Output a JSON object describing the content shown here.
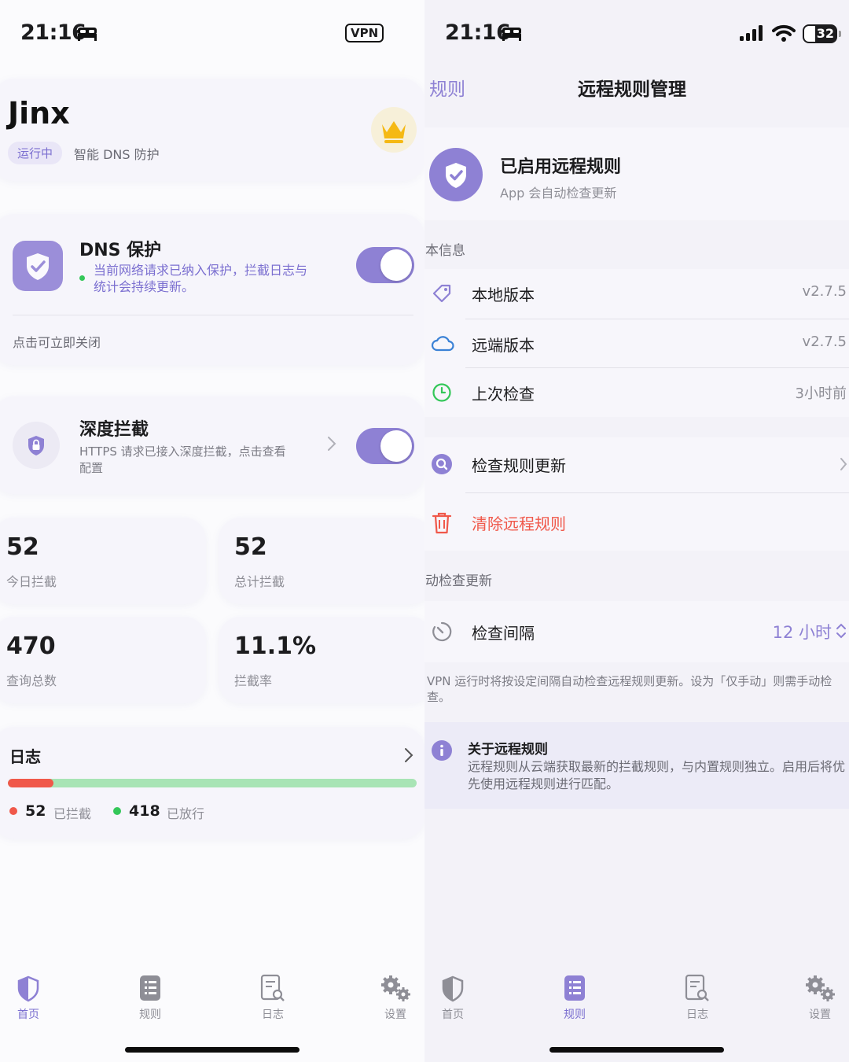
{
  "status": {
    "time": "21:16",
    "vpn_badge": "VPN",
    "battery": "32"
  },
  "home": {
    "app_name": "Jinx",
    "status_pill": "运行中",
    "subtitle": "智能 DNS 防护",
    "dns": {
      "title": "DNS 保护",
      "description": "当前网络请求已纳入保护，拦截日志与统计会持续更新。",
      "hint": "点击可立即关闭",
      "enabled": true
    },
    "deep": {
      "title": "深度拦截",
      "description": "HTTPS 请求已接入深度拦截，点击查看配置",
      "enabled": true
    },
    "stats": [
      {
        "value": "52",
        "label": "今日拦截"
      },
      {
        "value": "52",
        "label": "总计拦截"
      },
      {
        "value": "470",
        "label": "查询总数"
      },
      {
        "value": "11.1%",
        "label": "拦截率"
      }
    ],
    "log": {
      "title": "日志",
      "blocked_count": "52",
      "blocked_label": "已拦截",
      "allowed_count": "418",
      "allowed_label": "已放行",
      "blocked_fraction": 0.111
    }
  },
  "rules": {
    "back_label": "规则",
    "title": "远程规则管理",
    "enabled_title": "已启用远程规则",
    "enabled_subtitle": "App 会自动检查更新",
    "info_header": "本信息",
    "rows": [
      {
        "label": "本地版本",
        "value": "v2.7.5",
        "icon": "tag-icon"
      },
      {
        "label": "远端版本",
        "value": "v2.7.5",
        "icon": "cloud-icon"
      },
      {
        "label": "上次检查",
        "value": "3小时前",
        "icon": "clock-icon"
      }
    ],
    "check_update": "检查规则更新",
    "clear_rules": "清除远程规则",
    "auto_header": "动检查更新",
    "interval_label": "检查间隔",
    "interval_value": "12 小时",
    "footnote": "VPN 运行时将按设定间隔自动检查远程规则更新。设为「仅手动」则需手动检查。",
    "about_title": "关于远程规则",
    "about_body": "远程规则从云端获取最新的拦截规则，与内置规则独立。启用后将优先使用远程规则进行匹配。"
  },
  "tabs": [
    {
      "label": "首页",
      "icon": "shield-icon"
    },
    {
      "label": "规则",
      "icon": "list-icon"
    },
    {
      "label": "日志",
      "icon": "log-search-icon"
    },
    {
      "label": "设置",
      "icon": "gears-icon"
    }
  ],
  "colors": {
    "accent": "#8e81d4",
    "danger": "#f0584a",
    "success": "#34c759"
  }
}
